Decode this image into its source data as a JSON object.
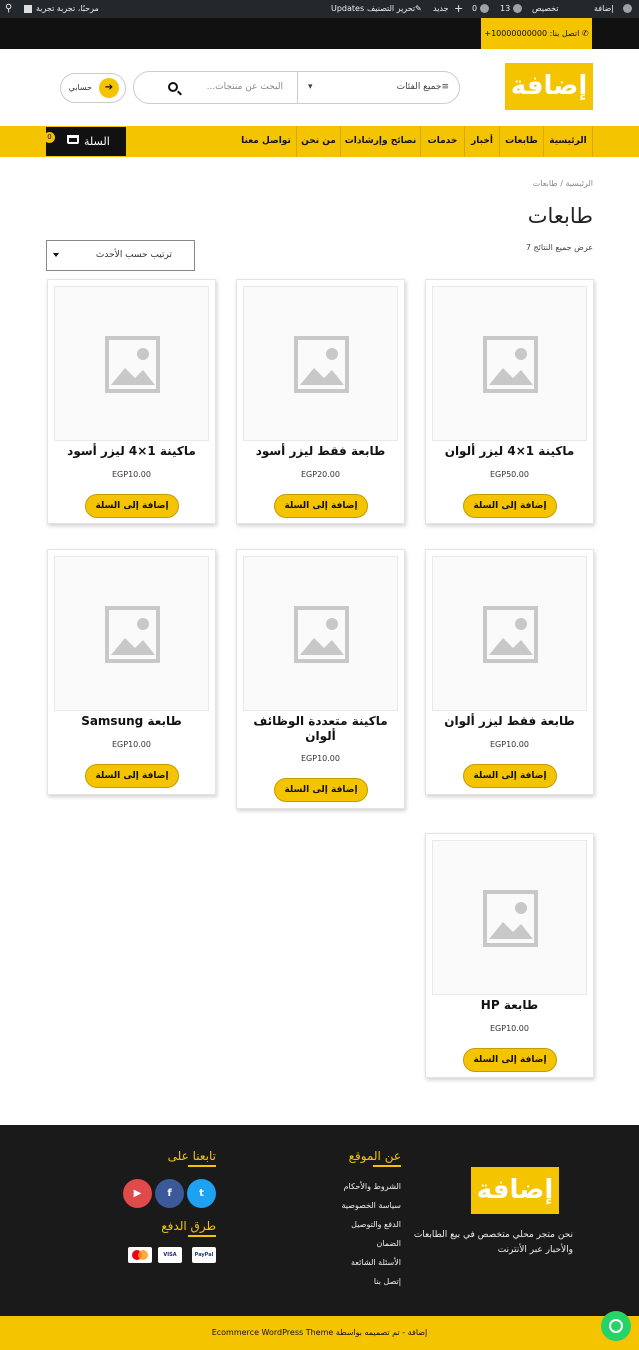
{
  "adminbar": {
    "site_name": "إضافة",
    "customize": "تخصيص",
    "updates_count": "13",
    "comments_count": "0",
    "new": "جديد",
    "edit_category": "تحرير التصنيف",
    "updates": "Updates",
    "greeting": "مرحبًا، تجربة تجربة"
  },
  "topbar": {
    "call": "اتصل بنا: 10000000000+"
  },
  "header": {
    "logo": "إضافة",
    "search_category": "جميع الفئات",
    "search_placeholder": "البحث عن منتجات...",
    "account": "حسابي"
  },
  "nav": {
    "items": [
      "الرئيسية",
      "طابعات",
      "أخبار",
      "خدمات",
      "نصائح وإرشادات",
      "من نحن",
      "تواصل معنا"
    ],
    "cart_label": "السلة",
    "cart_count": "0"
  },
  "page": {
    "breadcrumb": "الرئيسية / طابعات",
    "title": "طابعات",
    "result_count": "عرض جميع النتائج 7",
    "sort": "ترتيب حسب الأحدث"
  },
  "products": [
    {
      "name": "ماكينة 1×4 ليزر ألوان",
      "price": "EGP50.00",
      "button": "إضافة إلى السلة"
    },
    {
      "name": "طابعة فقط ليزر أسود",
      "price": "EGP20.00",
      "button": "إضافة إلى السلة"
    },
    {
      "name": "ماكينة 1×4 ليزر أسود",
      "price": "EGP10.00",
      "button": "إضافة إلى السلة"
    },
    {
      "name": "طابعة فقط ليزر ألوان",
      "price": "EGP10.00",
      "button": "إضافة إلى السلة"
    },
    {
      "name": "ماكينة متعددة الوظائف ألوان",
      "price": "EGP10.00",
      "button": "إضافة إلى السلة"
    },
    {
      "name": "طابعة Samsung",
      "price": "EGP10.00",
      "button": "إضافة إلى السلة"
    },
    {
      "name": "طابعة HP",
      "price": "EGP10.00",
      "button": "إضافة إلى السلة"
    }
  ],
  "footer": {
    "logo": "إضافة",
    "about": "نحن متجر محلي متخصص في بيع الطابعات والأحبار عبر الأنترنت",
    "site_heading": "عن الموقع",
    "links": [
      "الشروط والأحكام",
      "سياسة الخصوصية",
      "الدفع والتوصيل",
      "الضمان",
      "الأسئلة الشائعة",
      "إتصل بنا"
    ],
    "follow_heading": "تابعنا على",
    "payment_heading": "طرق الدفع",
    "payments": [
      "PayPal",
      "VISA",
      "mastercard"
    ],
    "socials": [
      "twitter-icon",
      "facebook-icon",
      "youtube-icon"
    ]
  },
  "copyright": "إضافة - تم تصميمه بواسطة Ecommerce WordPress Theme",
  "colors": {
    "accent": "#f5c400",
    "dark": "#111111",
    "admin_bar": "#23282d",
    "footer": "#1a1a1a"
  }
}
